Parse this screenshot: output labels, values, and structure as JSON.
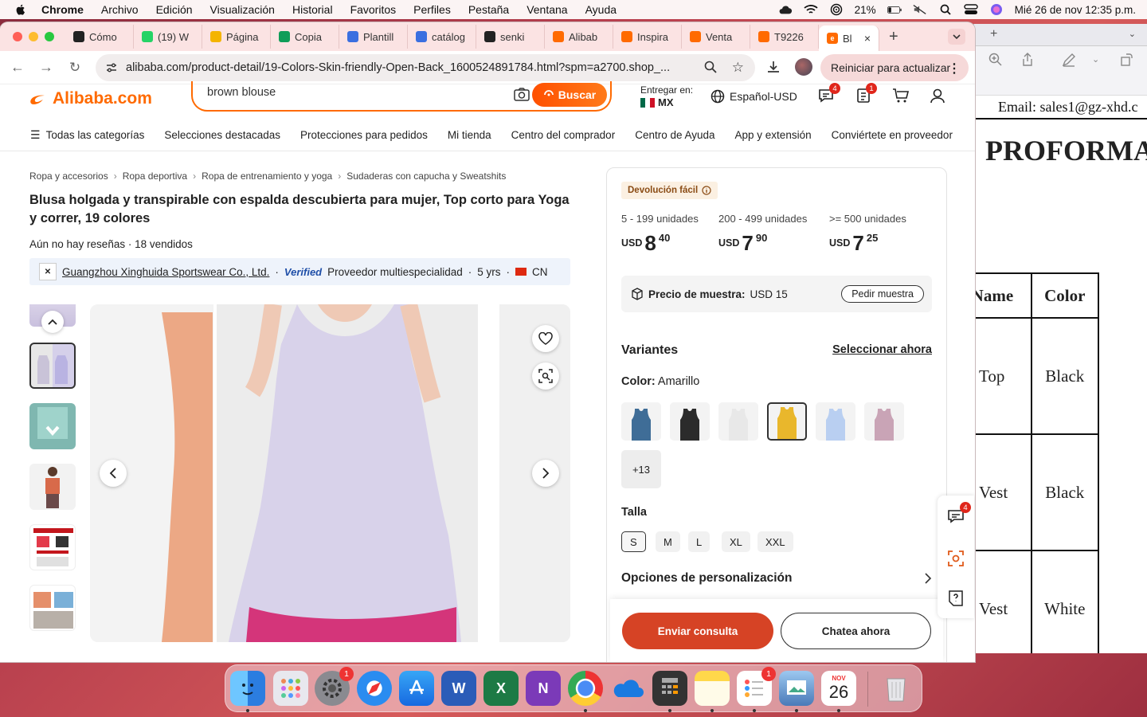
{
  "menubar": {
    "app": "Chrome",
    "items": [
      "Archivo",
      "Edición",
      "Visualización",
      "Historial",
      "Favoritos",
      "Perfiles",
      "Pestaña",
      "Ventana",
      "Ayuda"
    ],
    "battery": "21%",
    "datetime": "Mié 26 de nov  12:35 p.m."
  },
  "tabs": [
    {
      "label": "Cómo",
      "icon": "openai-icon",
      "color": "#222222"
    },
    {
      "label": "(19) W",
      "icon": "whatsapp-icon",
      "color": "#25d366"
    },
    {
      "label": "Página",
      "icon": "drive-icon",
      "color": "#f4b400"
    },
    {
      "label": "Copia",
      "icon": "sheets-icon",
      "color": "#0f9d58"
    },
    {
      "label": "Plantill",
      "icon": "canva-icon",
      "color": "#3b6fe0"
    },
    {
      "label": "catálog",
      "icon": "canva-icon",
      "color": "#3b6fe0"
    },
    {
      "label": "senki",
      "icon": "openai-icon",
      "color": "#222222"
    },
    {
      "label": "Alibab",
      "icon": "alibaba-icon",
      "color": "#ff6a00"
    },
    {
      "label": "Inspira",
      "icon": "alibaba-icon",
      "color": "#ff6a00"
    },
    {
      "label": "Venta",
      "icon": "alibaba-icon",
      "color": "#ff6a00"
    },
    {
      "label": "T9226",
      "icon": "alibaba-icon",
      "color": "#ff6a00"
    }
  ],
  "active_tab": {
    "label": "Bl",
    "icon": "alibaba-icon"
  },
  "toolbar": {
    "url": "alibaba.com/product-detail/19-Colors-Skin-friendly-Open-Back_1600524891784.html?spm=a2700.shop_...",
    "restart_label": "Reiniciar para actualizar"
  },
  "header": {
    "logo": "Alibaba.com",
    "search_query": "brown blouse",
    "search_button": "Buscar",
    "deliver_label": "Entregar en:",
    "deliver_country": "MX",
    "language": "Español-USD",
    "messages_badge": "4",
    "orders_badge": "1"
  },
  "catnav": [
    "Todas las categorías",
    "Selecciones destacadas",
    "Protecciones para pedidos",
    "Mi tienda",
    "Centro del comprador",
    "Centro de Ayuda",
    "App y extensión",
    "Conviértete en proveedor"
  ],
  "breadcrumb": [
    "Ropa y accesorios",
    "Ropa deportiva",
    "Ropa de entrenamiento y yoga",
    "Sudaderas con capucha y Sweatshits"
  ],
  "product": {
    "title": "Blusa holgada y transpirable con espalda descubierta para mujer, Top corto para Yoga y correr, 19 colores",
    "reviews": "Aún no hay reseñas · 18 vendidos",
    "supplier_name": "Guangzhou Xinghuida Sportswear Co., Ltd.",
    "verified": "Verified",
    "supplier_type": "Proveedor multiespecialidad",
    "years": "5 yrs",
    "country": "CN"
  },
  "pricing": {
    "easy_return": "Devolución fácil",
    "tiers": [
      {
        "range": "5 - 199 unidades",
        "currency": "USD",
        "int": "8",
        "dec": "40"
      },
      {
        "range": "200 - 499 unidades",
        "currency": "USD",
        "int": "7",
        "dec": "90"
      },
      {
        "range": ">= 500 unidades",
        "currency": "USD",
        "int": "7",
        "dec": "25"
      }
    ],
    "sample_label": "Precio de muestra:",
    "sample_price": "USD 15",
    "sample_button": "Pedir muestra"
  },
  "variants": {
    "title": "Variantes",
    "select_now": "Seleccionar ahora",
    "color_label": "Color:",
    "color_value": "Amarillo",
    "swatches": [
      {
        "name": "Azul",
        "color": "#3f6d97"
      },
      {
        "name": "Negro",
        "color": "#2b2b2b"
      },
      {
        "name": "Blanco",
        "color": "#e8e8e8"
      },
      {
        "name": "Amarillo",
        "color": "#e9b72c"
      },
      {
        "name": "Azul claro",
        "color": "#b9cff1"
      },
      {
        "name": "Rosa",
        "color": "#c9a4b6"
      }
    ],
    "more": "+13",
    "size_label": "Talla",
    "sizes": [
      "S",
      "M",
      "L",
      "XL",
      "XXL"
    ],
    "selected_size": "S",
    "custom_options": "Opciones de personalización"
  },
  "actions": {
    "inquiry": "Enviar consulta",
    "chat": "Chatea ahora",
    "float_badge": "4"
  },
  "doc": {
    "email": "Email: sales1@gz-xhd.c",
    "title": "PROFORMA",
    "col1": "uct Name",
    "col2": "Color",
    "rows": [
      {
        "name": "Top",
        "color": "Black"
      },
      {
        "name": "Vest",
        "color": "Black"
      },
      {
        "name": "Vest",
        "color": "White"
      }
    ]
  },
  "dock": {
    "settings_badge": "1",
    "reminders_badge": "1",
    "calendar_month": "NOV",
    "calendar_day": "26"
  }
}
